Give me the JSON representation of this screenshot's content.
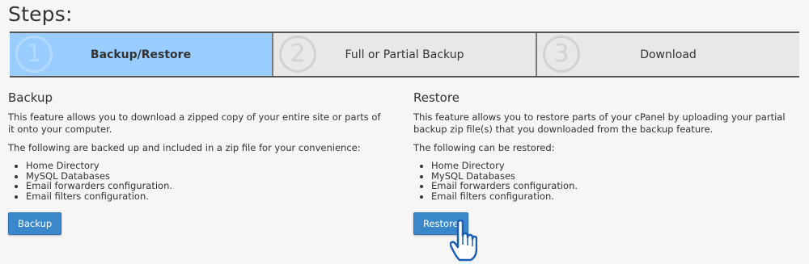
{
  "page": {
    "title": "Steps:"
  },
  "steps": [
    {
      "number": "1",
      "label": "Backup/Restore",
      "active": true
    },
    {
      "number": "2",
      "label": "Full or Partial Backup",
      "active": false
    },
    {
      "number": "3",
      "label": "Download",
      "active": false
    }
  ],
  "backup": {
    "heading": "Backup",
    "description": "This feature allows you to download a zipped copy of your entire site or parts of it onto your computer.",
    "intro": "The following are backed up and included in a zip file for your convenience:",
    "items": [
      "Home Directory",
      "MySQL Databases",
      "Email forwarders configuration.",
      "Email filters configuration."
    ],
    "button_label": "Backup"
  },
  "restore": {
    "heading": "Restore",
    "description": "This feature allows you to restore parts of your cPanel by uploading your partial backup zip file(s) that you downloaded from the backup feature.",
    "intro": "The following can be restored:",
    "items": [
      "Home Directory",
      "MySQL Databases",
      "Email forwarders configuration.",
      "Email filters configuration."
    ],
    "button_label": "Restore"
  },
  "colors": {
    "active_step": "#99ccff",
    "inactive_step": "#e8e8e8",
    "button": "#3a87c9"
  },
  "icons": {
    "cursor": "hand-pointer-icon"
  }
}
